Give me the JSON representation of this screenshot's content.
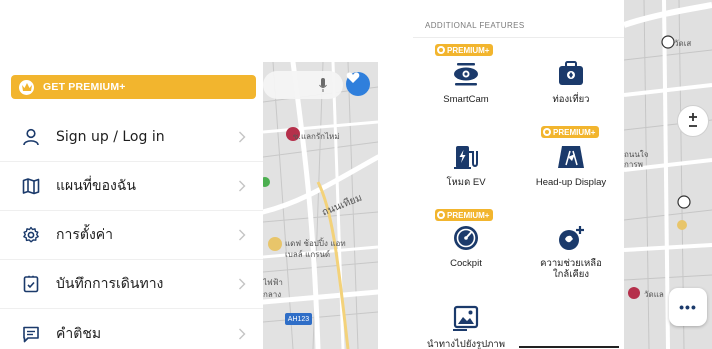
{
  "colors": {
    "brand_blue": "#1b3a6b",
    "premium_yellow": "#f2b52e",
    "accent_blue": "#2f7fdc"
  },
  "drawer": {
    "premium_button_label": "GET PREMIUM+",
    "items": [
      {
        "label": "Sign up / Log in",
        "icon": "person-icon"
      },
      {
        "label": "แผนที่ของฉัน",
        "icon": "map-icon"
      },
      {
        "label": "การตั้งค่า",
        "icon": "settings-gear-icon"
      },
      {
        "label": "บันทึกการเดินทาง",
        "icon": "trip-log-icon"
      },
      {
        "label": "คำติชม",
        "icon": "feedback-icon"
      }
    ]
  },
  "map_left": {
    "labels": [
      "ซ.แลกรักไหม่",
      "ถนนเทียม",
      "แดฟ ช้อปปิ้ง แอท",
      "เบลล์ แกรนด์",
      "ไฟฟ้า",
      "กลาง"
    ],
    "road_shield": "AH123"
  },
  "features": {
    "header": "ADDITIONAL FEATURES",
    "premium_badge": "PREMIUM+",
    "items": [
      {
        "label": "SmartCam",
        "premium": true,
        "icon": "smartcam-icon"
      },
      {
        "label": "ท่องเที่ยว",
        "premium": false,
        "icon": "travel-bag-icon"
      },
      {
        "label": "โหมด EV",
        "premium": false,
        "icon": "ev-charger-icon"
      },
      {
        "label": "Head-up Display",
        "premium": true,
        "icon": "head-up-display-icon"
      },
      {
        "label": "Cockpit",
        "premium": true,
        "icon": "cockpit-gauge-icon"
      },
      {
        "label": "ความช่วยเหลือ",
        "label2": "ใกล้เคียง",
        "premium": false,
        "icon": "nearby-help-icon"
      },
      {
        "label": "นำทางไปยังรูปภาพ",
        "premium": false,
        "icon": "navigate-to-photo-icon"
      }
    ]
  },
  "map_right": {
    "labels": [
      "วัดเส",
      "วัดแล",
      "ถนนใจ",
      "การพ"
    ],
    "more_button": "•••"
  }
}
